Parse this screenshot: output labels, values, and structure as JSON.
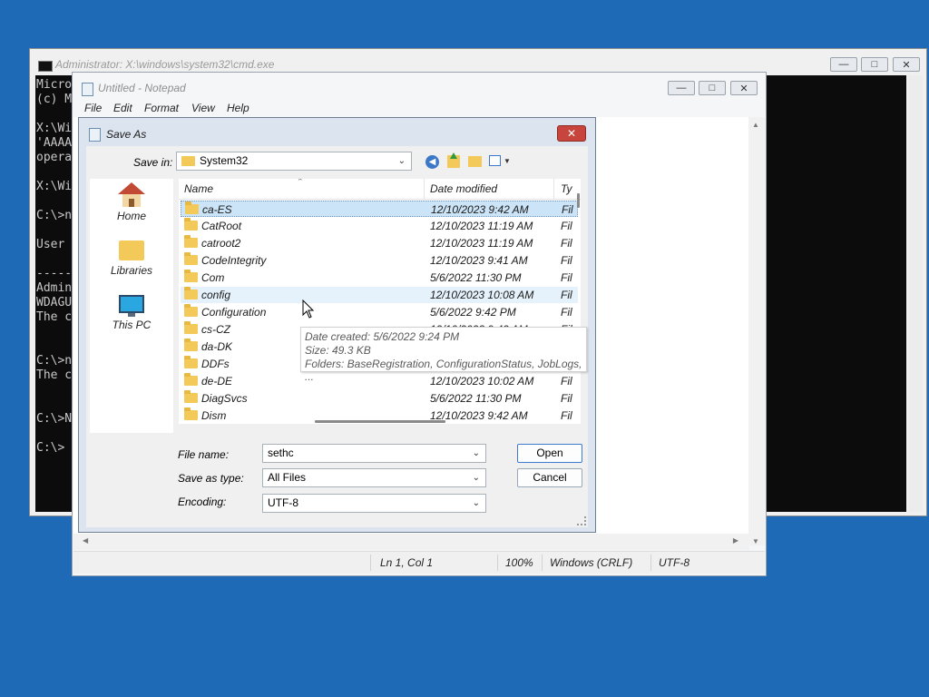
{
  "cmd": {
    "title": "Administrator: X:\\windows\\system32\\cmd.exe",
    "lines": [
      "Micro",
      "(c) M",
      "",
      "X:\\Wi",
      "'AAAA",
      "opera",
      "",
      "X:\\Wi",
      "",
      "C:\\>n",
      "",
      "User ",
      "",
      "-----",
      "Admin",
      "WDAGU",
      "The c",
      "",
      "",
      "C:\\>n",
      "The c",
      "",
      "",
      "C:\\>N",
      "",
      "C:\\>"
    ]
  },
  "notepad": {
    "title": "Untitled - Notepad",
    "menu": [
      "File",
      "Edit",
      "Format",
      "View",
      "Help"
    ],
    "status": {
      "position": "Ln 1, Col 1",
      "zoom": "100%",
      "line_ending": "Windows (CRLF)",
      "encoding": "UTF-8"
    }
  },
  "saveas": {
    "title": "Save As",
    "save_in_label": "Save in:",
    "save_in_value": "System32",
    "places": [
      {
        "label": "Home",
        "icon": "home-icon"
      },
      {
        "label": "Libraries",
        "icon": "libraries-icon"
      },
      {
        "label": "This PC",
        "icon": "this-pc-icon"
      }
    ],
    "columns": {
      "name": "Name",
      "date": "Date modified",
      "type": "Ty"
    },
    "files": [
      {
        "name": "ca-ES",
        "date": "12/10/2023 9:42 AM",
        "type": "Fil"
      },
      {
        "name": "CatRoot",
        "date": "12/10/2023 11:19 AM",
        "type": "Fil"
      },
      {
        "name": "catroot2",
        "date": "12/10/2023 11:19 AM",
        "type": "Fil"
      },
      {
        "name": "CodeIntegrity",
        "date": "12/10/2023 9:41 AM",
        "type": "Fil"
      },
      {
        "name": "Com",
        "date": "5/6/2022 11:30 PM",
        "type": "Fil"
      },
      {
        "name": "config",
        "date": "12/10/2023 10:08 AM",
        "type": "Fil"
      },
      {
        "name": "Configuration",
        "date": "5/6/2022 9:42 PM",
        "type": "Fil"
      },
      {
        "name": "cs-CZ",
        "date": "12/10/2023 9:42 AM",
        "type": "Fil"
      },
      {
        "name": "da-DK",
        "date": "12/10/2023 9:42 AM",
        "type": "Fil"
      },
      {
        "name": "DDFs",
        "date": "",
        "type": "Fil"
      },
      {
        "name": "de-DE",
        "date": "12/10/2023 10:02 AM",
        "type": "Fil"
      },
      {
        "name": "DiagSvcs",
        "date": "5/6/2022 11:30 PM",
        "type": "Fil"
      },
      {
        "name": "Dism",
        "date": "12/10/2023 9:42 AM",
        "type": "Fil"
      }
    ],
    "tooltip": {
      "created": "Date created: 5/6/2022 9:24 PM",
      "size": "Size: 49.3 KB",
      "folders": "Folders: BaseRegistration, ConfigurationStatus, JobLogs, ..."
    },
    "file_name_label": "File name:",
    "file_name_value": "sethc",
    "save_as_type_label": "Save as type:",
    "save_as_type_value": "All Files",
    "encoding_label": "Encoding:",
    "encoding_value": "UTF-8",
    "open_label": "Open",
    "cancel_label": "Cancel"
  }
}
